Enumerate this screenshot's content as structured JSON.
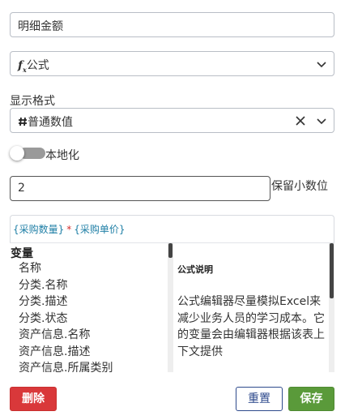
{
  "field_name": {
    "value": "明细金额"
  },
  "field_type": {
    "icon": "fx-icon",
    "label": "公式"
  },
  "format": {
    "section_label": "显示格式",
    "icon": "hash-icon",
    "selected": "普通数值"
  },
  "localize": {
    "label": "本地化",
    "enabled": false
  },
  "decimals": {
    "value": "2",
    "label": "保留小数位"
  },
  "formula": {
    "token1": "{采购数量}",
    "operator": "*",
    "token2": "{采购单价}"
  },
  "variables": {
    "heading": "变量",
    "items": [
      "名称",
      "分类.名称",
      "分类.描述",
      "分类.状态",
      "资产信息.名称",
      "资产信息.描述",
      "资产信息.所属类别"
    ]
  },
  "help": {
    "title": "公式说明",
    "body": "公式编辑器尽量模拟Excel来减少业务人员的学习成本。它的变量会由编辑器根据该表上下文提供"
  },
  "buttons": {
    "delete": "删除",
    "reset": "重置",
    "save": "保存"
  },
  "colors": {
    "delete": "#d9383a",
    "reset": "#2e4a8c",
    "save": "#5a9a3a",
    "formula_token": "#1f7fa6",
    "operator": "#d32f2f"
  }
}
